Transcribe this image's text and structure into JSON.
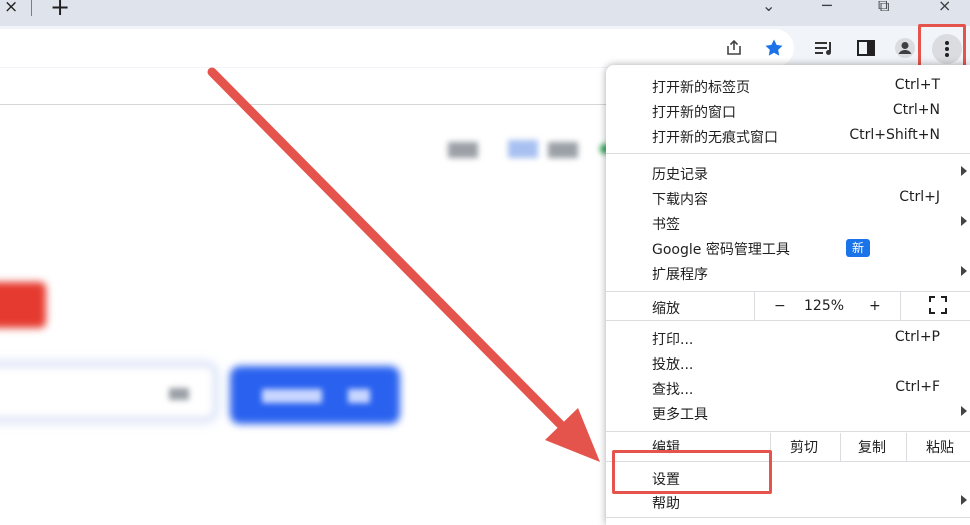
{
  "tabstrip": {
    "close_glyph": "×",
    "newtab_glyph": "+",
    "collapse_glyph": "⌄",
    "minimize_glyph": "─",
    "restore_glyph": "⧉",
    "winclose_glyph": "×"
  },
  "toolbar": {
    "share_icon": "share-icon",
    "bookmark_icon": "star-icon",
    "reading_list_icon": "reading-list-icon",
    "side_panel_icon": "side-panel-icon",
    "profile_icon": "profile-icon",
    "menu_icon": "kebab-menu-icon"
  },
  "menu": {
    "new_tab": {
      "label": "打开新的标签页",
      "shortcut": "Ctrl+T"
    },
    "new_window": {
      "label": "打开新的窗口",
      "shortcut": "Ctrl+N"
    },
    "incognito": {
      "label": "打开新的无痕式窗口",
      "shortcut": "Ctrl+Shift+N"
    },
    "history": {
      "label": "历史记录"
    },
    "downloads": {
      "label": "下载内容",
      "shortcut": "Ctrl+J"
    },
    "bookmarks": {
      "label": "书签"
    },
    "password_manager": {
      "label": "Google 密码管理工具",
      "badge": "新"
    },
    "extensions": {
      "label": "扩展程序"
    },
    "zoom": {
      "label": "缩放",
      "minus": "−",
      "value": "125%",
      "plus": "+"
    },
    "print": {
      "label": "打印...",
      "shortcut": "Ctrl+P"
    },
    "cast": {
      "label": "投放..."
    },
    "find": {
      "label": "查找...",
      "shortcut": "Ctrl+F"
    },
    "more_tools": {
      "label": "更多工具"
    },
    "edit": {
      "label": "编辑",
      "cut": "剪切",
      "copy": "复制",
      "paste": "粘贴"
    },
    "settings": {
      "label": "设置"
    },
    "help": {
      "label": "帮助"
    }
  },
  "colors": {
    "annotation_red": "#e4534c",
    "badge_blue": "#1a73e8",
    "star_blue": "#1a73e8"
  }
}
